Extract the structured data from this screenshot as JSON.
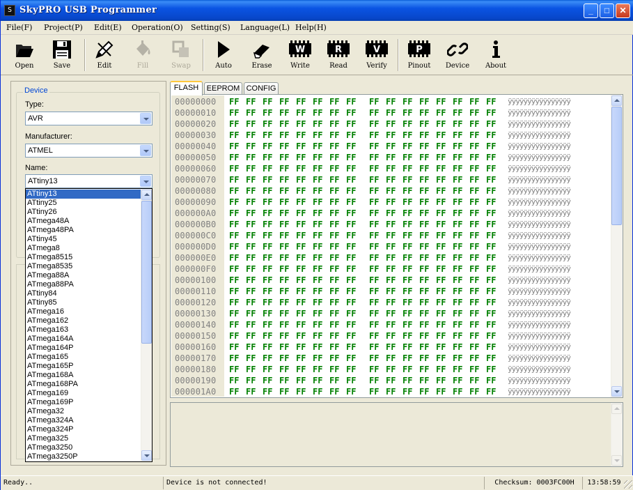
{
  "window": {
    "title": "SkyPRO USB Programmer",
    "min": "_",
    "max": "□",
    "close": "✕",
    "icon": "S"
  },
  "menu": [
    "File(F)",
    "Project(P)",
    "Edit(E)",
    "Operation(O)",
    "Setting(S)",
    "Language(L)",
    "Help(H)"
  ],
  "toolbar": [
    {
      "label": "Open",
      "icon": "folder-open-icon",
      "enabled": true
    },
    {
      "label": "Save",
      "icon": "floppy-icon",
      "enabled": true
    },
    {
      "label": "Edit",
      "icon": "pen-icon",
      "enabled": true
    },
    {
      "label": "Fill",
      "icon": "paint-bucket-icon",
      "enabled": false
    },
    {
      "label": "Swap",
      "icon": "swap-icon",
      "enabled": false
    },
    {
      "label": "Auto",
      "icon": "play-icon",
      "enabled": true
    },
    {
      "label": "Erase",
      "icon": "eraser-icon",
      "enabled": true
    },
    {
      "label": "Write",
      "icon": "chip-w-icon",
      "enabled": true
    },
    {
      "label": "Read",
      "icon": "chip-r-icon",
      "enabled": true
    },
    {
      "label": "Verify",
      "icon": "chip-v-icon",
      "enabled": true
    },
    {
      "label": "Pinout",
      "icon": "chip-p-icon",
      "enabled": true
    },
    {
      "label": "Device",
      "icon": "link-icon",
      "enabled": true
    },
    {
      "label": "About",
      "icon": "info-icon",
      "enabled": true
    }
  ],
  "chip_letters": {
    "write": "W",
    "read": "R",
    "verify": "V",
    "pinout": "P"
  },
  "device": {
    "group_title": "Device",
    "type_label": "Type:",
    "type_value": "AVR",
    "manufacturer_label": "Manufacturer:",
    "manufacturer_value": "ATMEL",
    "name_label": "Name:",
    "name_value": "ATtiny13",
    "name_options": [
      "ATtiny13",
      "ATtiny25",
      "ATtiny26",
      "ATmega48A",
      "ATmega48PA",
      "ATtiny45",
      "ATmega8",
      "ATmega8515",
      "ATmega8535",
      "ATmega88A",
      "ATmega88PA",
      "ATtiny84",
      "ATtiny85",
      "ATmega16",
      "ATmega162",
      "ATmega163",
      "ATmega164A",
      "ATmega164P",
      "ATmega165",
      "ATmega165P",
      "ATmega168A",
      "ATmega168PA",
      "ATmega169",
      "ATmega169P",
      "ATmega32",
      "ATmega324A",
      "ATmega324P",
      "ATmega325",
      "ATmega3250",
      "ATmega3250P"
    ],
    "selected_index": 0
  },
  "tabs": [
    "FLASH",
    "EEPROM",
    "CONFIG"
  ],
  "active_tab": 0,
  "hex": {
    "addresses": [
      "00000000",
      "00000010",
      "00000020",
      "00000030",
      "00000040",
      "00000050",
      "00000060",
      "00000070",
      "00000080",
      "00000090",
      "000000A0",
      "000000B0",
      "000000C0",
      "000000D0",
      "000000E0",
      "000000F0",
      "00000100",
      "00000110",
      "00000120",
      "00000130",
      "00000140",
      "00000150",
      "00000160",
      "00000170",
      "00000180",
      "00000190",
      "000001A0"
    ],
    "byte": "FF",
    "ascii": "ÿÿÿÿÿÿÿÿÿÿÿÿÿÿÿÿ"
  },
  "status": {
    "left": "Ready..",
    "connection": "Device is not connected!",
    "checksum": "Checksum: 0003FC00H",
    "time": "13:58:59"
  }
}
